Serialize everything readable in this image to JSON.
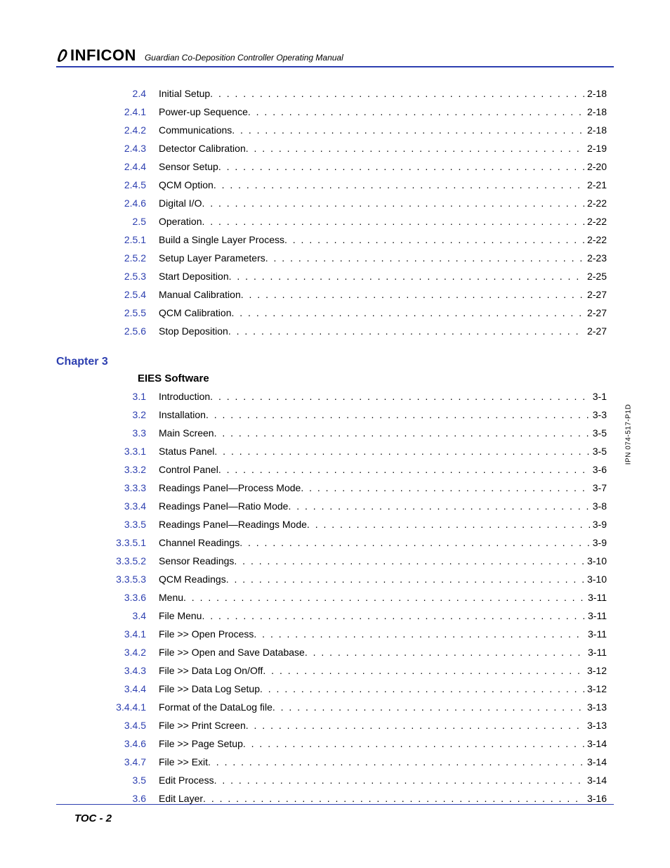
{
  "header": {
    "brand": "INFICON",
    "manual_title": "Guardian Co-Deposition Controller Operating Manual"
  },
  "side_label": "IPN 074-517-P1D",
  "footer": "TOC - 2",
  "chapter3": {
    "label": "Chapter 3",
    "title": "EIES Software"
  },
  "toc_top": [
    {
      "num": "2.4",
      "title": "Initial Setup",
      "page": "2-18"
    },
    {
      "num": "2.4.1",
      "title": "Power-up Sequence",
      "page": "2-18"
    },
    {
      "num": "2.4.2",
      "title": "Communications",
      "page": "2-18"
    },
    {
      "num": "2.4.3",
      "title": "Detector Calibration",
      "page": "2-19"
    },
    {
      "num": "2.4.4",
      "title": "Sensor Setup",
      "page": "2-20"
    },
    {
      "num": "2.4.5",
      "title": "QCM Option",
      "page": "2-21"
    },
    {
      "num": "2.4.6",
      "title": "Digital I/O",
      "page": "2-22"
    },
    {
      "num": "2.5",
      "title": "Operation",
      "page": "2-22"
    },
    {
      "num": "2.5.1",
      "title": "Build a Single Layer Process",
      "page": "2-22"
    },
    {
      "num": "2.5.2",
      "title": "Setup Layer Parameters",
      "page": "2-23"
    },
    {
      "num": "2.5.3",
      "title": "Start Deposition",
      "page": "2-25"
    },
    {
      "num": "2.5.4",
      "title": "Manual Calibration",
      "page": "2-27"
    },
    {
      "num": "2.5.5",
      "title": "QCM Calibration",
      "page": "2-27"
    },
    {
      "num": "2.5.6",
      "title": "Stop Deposition",
      "page": "2-27"
    }
  ],
  "toc_ch3": [
    {
      "num": "3.1",
      "title": "Introduction",
      "page": "3-1"
    },
    {
      "num": "3.2",
      "title": "Installation",
      "page": "3-3"
    },
    {
      "num": "3.3",
      "title": "Main Screen",
      "page": "3-5"
    },
    {
      "num": "3.3.1",
      "title": "Status Panel",
      "page": "3-5"
    },
    {
      "num": "3.3.2",
      "title": "Control Panel",
      "page": "3-6"
    },
    {
      "num": "3.3.3",
      "title": "Readings Panel—Process Mode",
      "page": "3-7"
    },
    {
      "num": "3.3.4",
      "title": "Readings Panel—Ratio Mode",
      "page": "3-8"
    },
    {
      "num": "3.3.5",
      "title": "Readings Panel—Readings Mode",
      "page": "3-9"
    },
    {
      "num": "3.3.5.1",
      "title": "Channel Readings",
      "page": "3-9"
    },
    {
      "num": "3.3.5.2",
      "title": "Sensor Readings",
      "page": "3-10"
    },
    {
      "num": "3.3.5.3",
      "title": "QCM Readings",
      "page": "3-10"
    },
    {
      "num": "3.3.6",
      "title": "Menu",
      "page": "3-11"
    },
    {
      "num": "3.4",
      "title": "File Menu",
      "page": "3-11"
    },
    {
      "num": "3.4.1",
      "title": "File >> Open Process",
      "page": "3-11"
    },
    {
      "num": "3.4.2",
      "title": "File >> Open and Save Database",
      "page": "3-11"
    },
    {
      "num": "3.4.3",
      "title": "File >> Data Log On/Off",
      "page": "3-12"
    },
    {
      "num": "3.4.4",
      "title": "File >> Data Log Setup",
      "page": "3-12"
    },
    {
      "num": "3.4.4.1",
      "title": "Format of the DataLog file",
      "page": "3-13"
    },
    {
      "num": "3.4.5",
      "title": "File >> Print Screen",
      "page": "3-13"
    },
    {
      "num": "3.4.6",
      "title": "File >> Page Setup",
      "page": "3-14"
    },
    {
      "num": "3.4.7",
      "title": "File >> Exit",
      "page": "3-14"
    },
    {
      "num": "3.5",
      "title": "Edit Process",
      "page": "3-14"
    },
    {
      "num": "3.6",
      "title": "Edit Layer",
      "page": "3-16"
    }
  ]
}
